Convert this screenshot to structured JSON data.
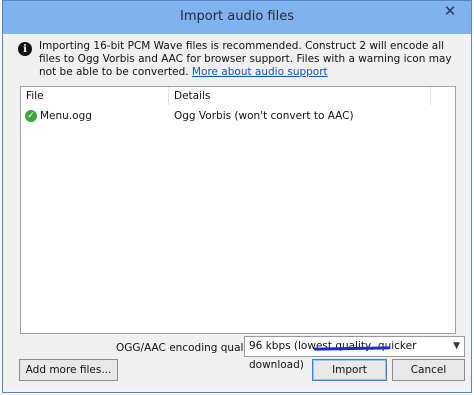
{
  "window": {
    "title": "Import audio files",
    "close_glyph": "✕"
  },
  "info": {
    "icon": "i",
    "text": "Importing 16-bit PCM Wave files is recommended.  Construct 2 will encode all files to Ogg Vorbis and AAC for browser support.  Files with a warning icon may not be able to be converted. ",
    "link": "More about audio support"
  },
  "list": {
    "columns": [
      "File",
      "Details"
    ],
    "rows": [
      {
        "file": "Menu.ogg",
        "details": "Ogg Vorbis (won't convert to AAC)"
      }
    ]
  },
  "quality": {
    "label": "OGG/AAC encoding quality:",
    "selected": "96 kbps (lowest quality, quicker download)"
  },
  "buttons": {
    "add": "Add more files...",
    "import": "Import",
    "cancel": "Cancel"
  },
  "colors": {
    "titlebar": "#7fb2ee",
    "link": "#1a4fc8",
    "annotation": "#1a2bd6"
  }
}
